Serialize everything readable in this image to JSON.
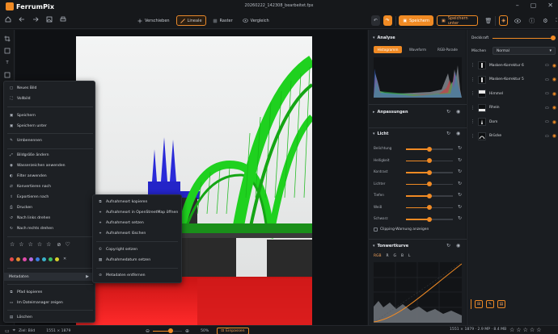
{
  "app": {
    "name": "FerrumPix",
    "file_title": "20260222_142308_bearbeitet.fpx"
  },
  "colors": {
    "accent": "#f08a24",
    "bg": "#141619",
    "panel": "#1a1d21"
  },
  "toolbar": {
    "left_icons": [
      "home-icon",
      "back-arrow-icon",
      "forward-arrow-icon",
      "image-icon",
      "print-icon"
    ],
    "tools": [
      {
        "label": "Verschieben",
        "icon": "move-icon",
        "active": false
      },
      {
        "label": "Lineale",
        "icon": "ruler-icon",
        "active": true
      },
      {
        "label": "Raster",
        "icon": "grid-icon",
        "active": false
      },
      {
        "label": "Vergleich",
        "icon": "eye-icon",
        "active": false
      }
    ],
    "save_label": "Speichern",
    "save_as_label": "Speichern unter"
  },
  "context_menu": {
    "items": [
      {
        "label": "Neues Bild",
        "icon": "new-image-icon"
      },
      {
        "label": "Vollbild",
        "icon": "fullscreen-icon"
      },
      {
        "label": "Speichern",
        "icon": "save-icon"
      },
      {
        "label": "Speichern unter",
        "icon": "save-as-icon"
      },
      {
        "label": "Umbenennen",
        "icon": "rename-icon"
      },
      {
        "label": "Bildgröße ändern",
        "icon": "resize-icon"
      },
      {
        "label": "Wasserzeichen anwenden",
        "icon": "watermark-icon"
      },
      {
        "label": "Filter anwenden",
        "icon": "filter-icon"
      },
      {
        "label": "Konvertieren nach",
        "icon": "convert-icon"
      },
      {
        "label": "Exportieren nach",
        "icon": "export-icon"
      },
      {
        "label": "Drucken",
        "icon": "print-icon"
      },
      {
        "label": "Nach links drehen",
        "icon": "rotate-left-icon"
      },
      {
        "label": "Nach rechts drehen",
        "icon": "rotate-right-icon"
      }
    ],
    "metadata_label": "Metadaten",
    "bottom_items": [
      {
        "label": "Pfad kopieren",
        "icon": "copy-path-icon"
      },
      {
        "label": "Im Dateimanager zeigen",
        "icon": "folder-icon"
      },
      {
        "label": "Löschen",
        "icon": "trash-icon"
      }
    ],
    "color_swatches": [
      "#e24a4a",
      "#e08a2e",
      "#e04aa8",
      "#b26ae0",
      "#3a7ee0",
      "#3ab0c8",
      "#3ac06a",
      "#d8d02c"
    ]
  },
  "submenu": {
    "items": [
      {
        "label": "Aufnahmeort kopieren",
        "icon": "copy-location-icon"
      },
      {
        "label": "Aufnahmeort in OpenStreetMap öffnen",
        "icon": "map-icon"
      },
      {
        "label": "Aufnahmeort setzen",
        "icon": "location-set-icon"
      },
      {
        "label": "Aufnahmeort löschen",
        "icon": "location-delete-icon"
      },
      {
        "label": "Copyright setzen",
        "icon": "copyright-icon"
      },
      {
        "label": "Aufnahmedatum setzen",
        "icon": "calendar-icon"
      },
      {
        "label": "Metadaten entfernen",
        "icon": "metadata-remove-icon"
      }
    ]
  },
  "analysis": {
    "title": "Analyse",
    "tabs": [
      "Histogramm",
      "Waveform",
      "RGB-Parade"
    ],
    "active_tab": "Histogramm"
  },
  "adjustments": {
    "title": "Anpassungen"
  },
  "light": {
    "title": "Licht",
    "sliders": [
      {
        "label": "Belichtung",
        "value": 0.5
      },
      {
        "label": "Helligkeit",
        "value": 0.5
      },
      {
        "label": "Kontrast",
        "value": 0.5
      },
      {
        "label": "Lichter",
        "value": 0.5
      },
      {
        "label": "Tiefen",
        "value": 0.5
      },
      {
        "label": "Weiß",
        "value": 0.5
      },
      {
        "label": "Schwarz",
        "value": 0.5
      }
    ],
    "clipping_label": "Clipping-Warnung anzeigen"
  },
  "tone_curve": {
    "title": "Tonwertkurve",
    "channels": [
      "RGB",
      "R",
      "G",
      "B",
      "L"
    ],
    "active_channel": "RGB"
  },
  "layers": {
    "opacity_label": "Deckkraft",
    "opacity_value": 1.0,
    "blend_label": "Mischen",
    "blend_value": "Normal",
    "items": [
      {
        "name": "Masken-Korrektur 6"
      },
      {
        "name": "Masken-Korrektur 5"
      },
      {
        "name": "Himmel"
      },
      {
        "name": "Rhein"
      },
      {
        "name": "Dom"
      },
      {
        "name": "Brücke"
      }
    ]
  },
  "status": {
    "folder_label": "Ziel: Bild",
    "dimensions": "1551 × 1879",
    "zoom": "50%",
    "fit_label": "Einpassen",
    "file_info": "1551 × 1879 · 2.9 MP · 8.4 MB"
  }
}
